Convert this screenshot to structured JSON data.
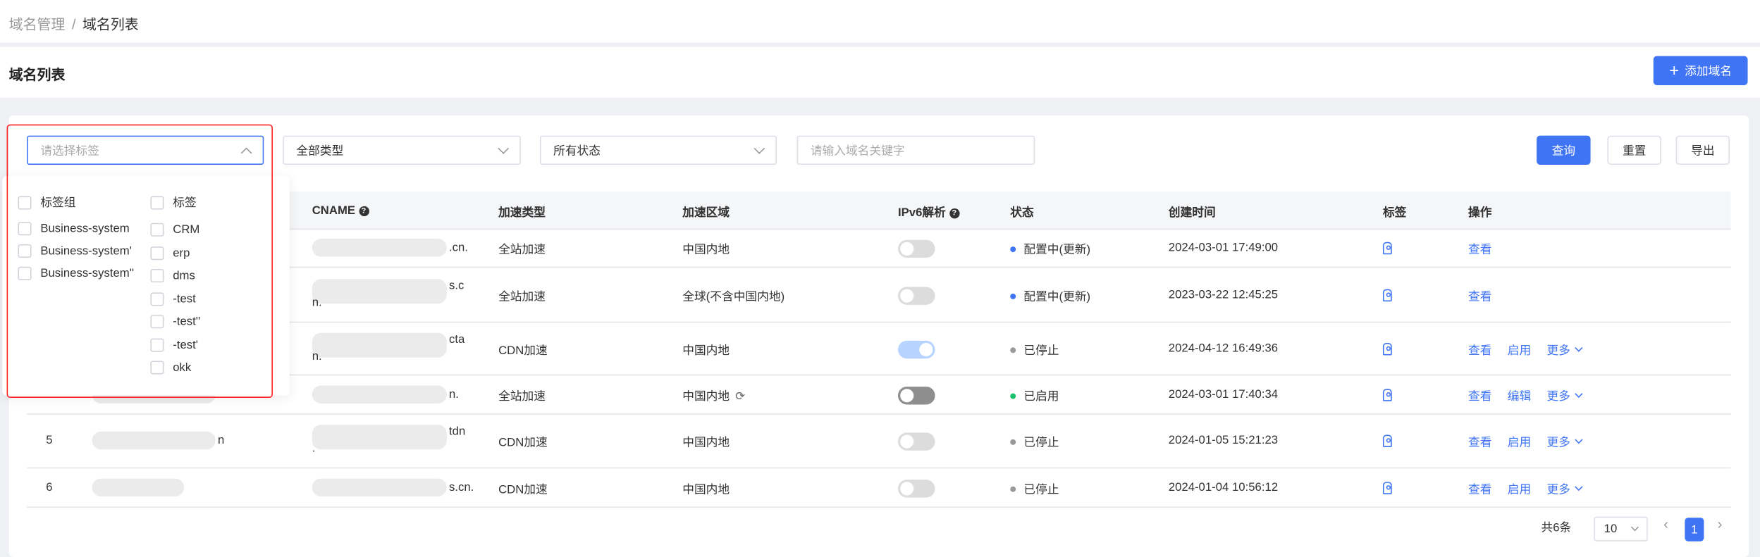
{
  "breadcrumb": {
    "parent": "域名管理",
    "separator": "/",
    "current": "域名列表"
  },
  "page_title": "域名列表",
  "add_button": {
    "icon": "plus-icon",
    "label": "添加域名"
  },
  "filters": {
    "tag_placeholder": "请选择标签",
    "type_value": "全部类型",
    "status_value": "所有状态",
    "keyword_placeholder": "请输入域名关键字",
    "query": "查询",
    "reset": "重置",
    "export": "导出"
  },
  "tag_dropdown": {
    "groups_header": "标签组",
    "tags_header": "标签",
    "groups": [
      "Business-system",
      "Business-system'",
      "Business-system''"
    ],
    "tags": [
      "CRM",
      "erp",
      "dms",
      "-test",
      "-test''",
      "-test'",
      "okk"
    ]
  },
  "table": {
    "columns": {
      "cname": "CNAME",
      "type": "加速类型",
      "region": "加速区域",
      "ipv6": "IPv6解析",
      "status": "状态",
      "created": "创建时间",
      "tag": "标签",
      "ops": "操作"
    },
    "rows": [
      {
        "index": "",
        "domain_tail": "",
        "cname_tail": ".cn.",
        "type": "全站加速",
        "region": "中国内地",
        "ipv6": "off",
        "status": "配置中(更新)",
        "status_color": "#3f74f5",
        "created": "2024-03-01 17:49:00",
        "ops": [
          "查看"
        ]
      },
      {
        "index": "",
        "domain_tail": "",
        "cname_tail": "s.c",
        "cname_tail2": "n.",
        "type": "全站加速",
        "region": "全球(不含中国内地)",
        "ipv6": "off",
        "status": "配置中(更新)",
        "status_color": "#3f74f5",
        "created": "2023-03-22 12:45:25",
        "ops": [
          "查看"
        ]
      },
      {
        "index": "",
        "domain_tail": "",
        "cname_tail": "cta",
        "cname_tail2": "n.",
        "type": "CDN加速",
        "region": "中国内地",
        "ipv6": "on",
        "status": "已停止",
        "status_color": "#999999",
        "created": "2024-04-12 16:49:36",
        "ops": [
          "查看",
          "启用",
          "更多"
        ]
      },
      {
        "index": "",
        "domain_tail": "",
        "cname_tail": "n.",
        "type": "全站加速",
        "region": "中国内地",
        "region_icon": "refresh-icon",
        "ipv6": "dark",
        "status": "已启用",
        "status_color": "#19be6b",
        "created": "2024-03-01 17:40:34",
        "ops": [
          "查看",
          "编辑",
          "更多"
        ]
      },
      {
        "index": "5",
        "domain_tail": "n",
        "cname_tail": "tdn",
        "cname_tail2": ".",
        "type": "CDN加速",
        "region": "中国内地",
        "ipv6": "off",
        "status": "已停止",
        "status_color": "#999999",
        "created": "2024-01-05 15:21:23",
        "ops": [
          "查看",
          "启用",
          "更多"
        ]
      },
      {
        "index": "6",
        "domain_tail": "",
        "cname_tail": "s.cn.",
        "type": "CDN加速",
        "region": "中国内地",
        "ipv6": "off",
        "status": "已停止",
        "status_color": "#999999",
        "created": "2024-01-04 10:56:12",
        "ops": [
          "查看",
          "启用",
          "更多"
        ]
      }
    ]
  },
  "pagination": {
    "total": "共6条",
    "page_size": "10",
    "current_page": "1"
  },
  "colors": {
    "primary": "#3f74f5",
    "highlight": "#ff2222"
  }
}
